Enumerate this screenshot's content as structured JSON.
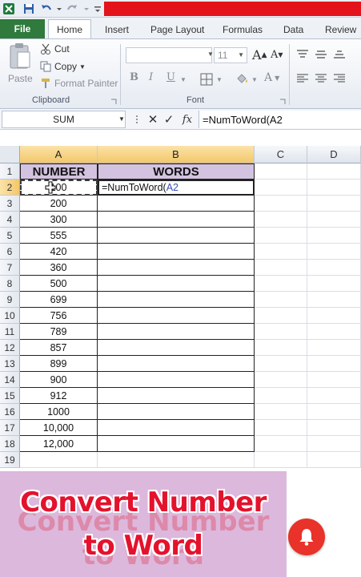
{
  "tabs": [
    "File",
    "Home",
    "Insert",
    "Page Layout",
    "Formulas",
    "Data",
    "Review"
  ],
  "ribbon": {
    "paste_label": "Paste",
    "cut_label": "Cut",
    "copy_label": "Copy",
    "format_painter_label": "Format Painter",
    "clipboard_group": "Clipboard",
    "font_size": "11",
    "grow_font": "A",
    "shrink_font": "A",
    "bold": "B",
    "italic": "I",
    "underline": "U",
    "font_color": "A",
    "font_group": "Font"
  },
  "formula_bar": {
    "name_box": "SUM",
    "cancel": "✕",
    "enter": "✓",
    "fx": "fx",
    "formula": "=NumToWord(A2"
  },
  "columns": [
    "A",
    "B",
    "C",
    "D"
  ],
  "rows": [
    "1",
    "2",
    "3",
    "4",
    "5",
    "6",
    "7",
    "8",
    "9",
    "10",
    "11",
    "12",
    "13",
    "14",
    "15",
    "16",
    "17",
    "18",
    "19"
  ],
  "table": {
    "header_number": "NUMBER",
    "header_words": "WORDS",
    "numbers": [
      "100",
      "200",
      "300",
      "555",
      "420",
      "360",
      "500",
      "699",
      "756",
      "789",
      "857",
      "899",
      "900",
      "912",
      "1000",
      "10,000",
      "12,000"
    ],
    "b2_prefix": "=NumToWord(",
    "b2_ref": "A2"
  },
  "banner": {
    "line1": "Convert Number",
    "line2": "to Word"
  },
  "colors": {
    "excel_green": "#2f7a3c",
    "header_fill": "#d3c3e0",
    "banner_bg": "#dcb8dc",
    "banner_text": "#e4122c",
    "bell": "#e8322a"
  }
}
